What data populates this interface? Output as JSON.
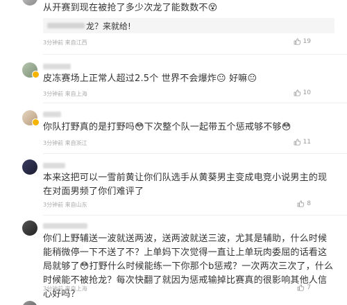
{
  "comments": [
    {
      "username": "",
      "text": "从开赛到现在被抢了多少次龙了能数数不😵",
      "reply": "龙？来就给!",
      "time": "3分钟前",
      "location": "来自江西",
      "likes": "19"
    },
    {
      "username": "",
      "text": "皮冻赛场上正常人超过2.5个 世界不会爆炸😐 好嘛😐",
      "time": "3分钟前",
      "location": "来自上海",
      "likes": "10"
    },
    {
      "username": "",
      "text": "你队打野真的是打野吗😳下次整个队一起带五个惩戒够不够😳",
      "time": "3分钟前",
      "location": "来自浙江",
      "likes": "11"
    },
    {
      "username": "",
      "text": "本来这把可以一雪前黄让你们队选手从黄葵男主变成电竞小说男主的现在对面男频了你们难评了",
      "time": "3分钟前",
      "location": "来自山东",
      "likes": "8"
    },
    {
      "username": "",
      "text": "你们上野辅送一波就送两波，送两波就送三波，尤其是辅助，什么时候能稍微停一下不送了不？上单妈下次觉得一直让上单玩肉委屈的话看这局就够了😳打野什么时候能练一下你那个b惩戒？一次两次三次了，什么时候能不被抢龙？每次快翻了就因为惩戒输掉比赛真的很影响其他人信心好吗？",
      "time": "3分钟前",
      "location": "来自上海",
      "likes": "7"
    }
  ],
  "icons": {
    "like": "thumbs-up-icon",
    "badge": "verified-badge-icon"
  },
  "colors": {
    "text": "#333333",
    "meta": "#aaaaaa",
    "reply_bg": "#f5f5f5",
    "badge": "#f5b400"
  }
}
